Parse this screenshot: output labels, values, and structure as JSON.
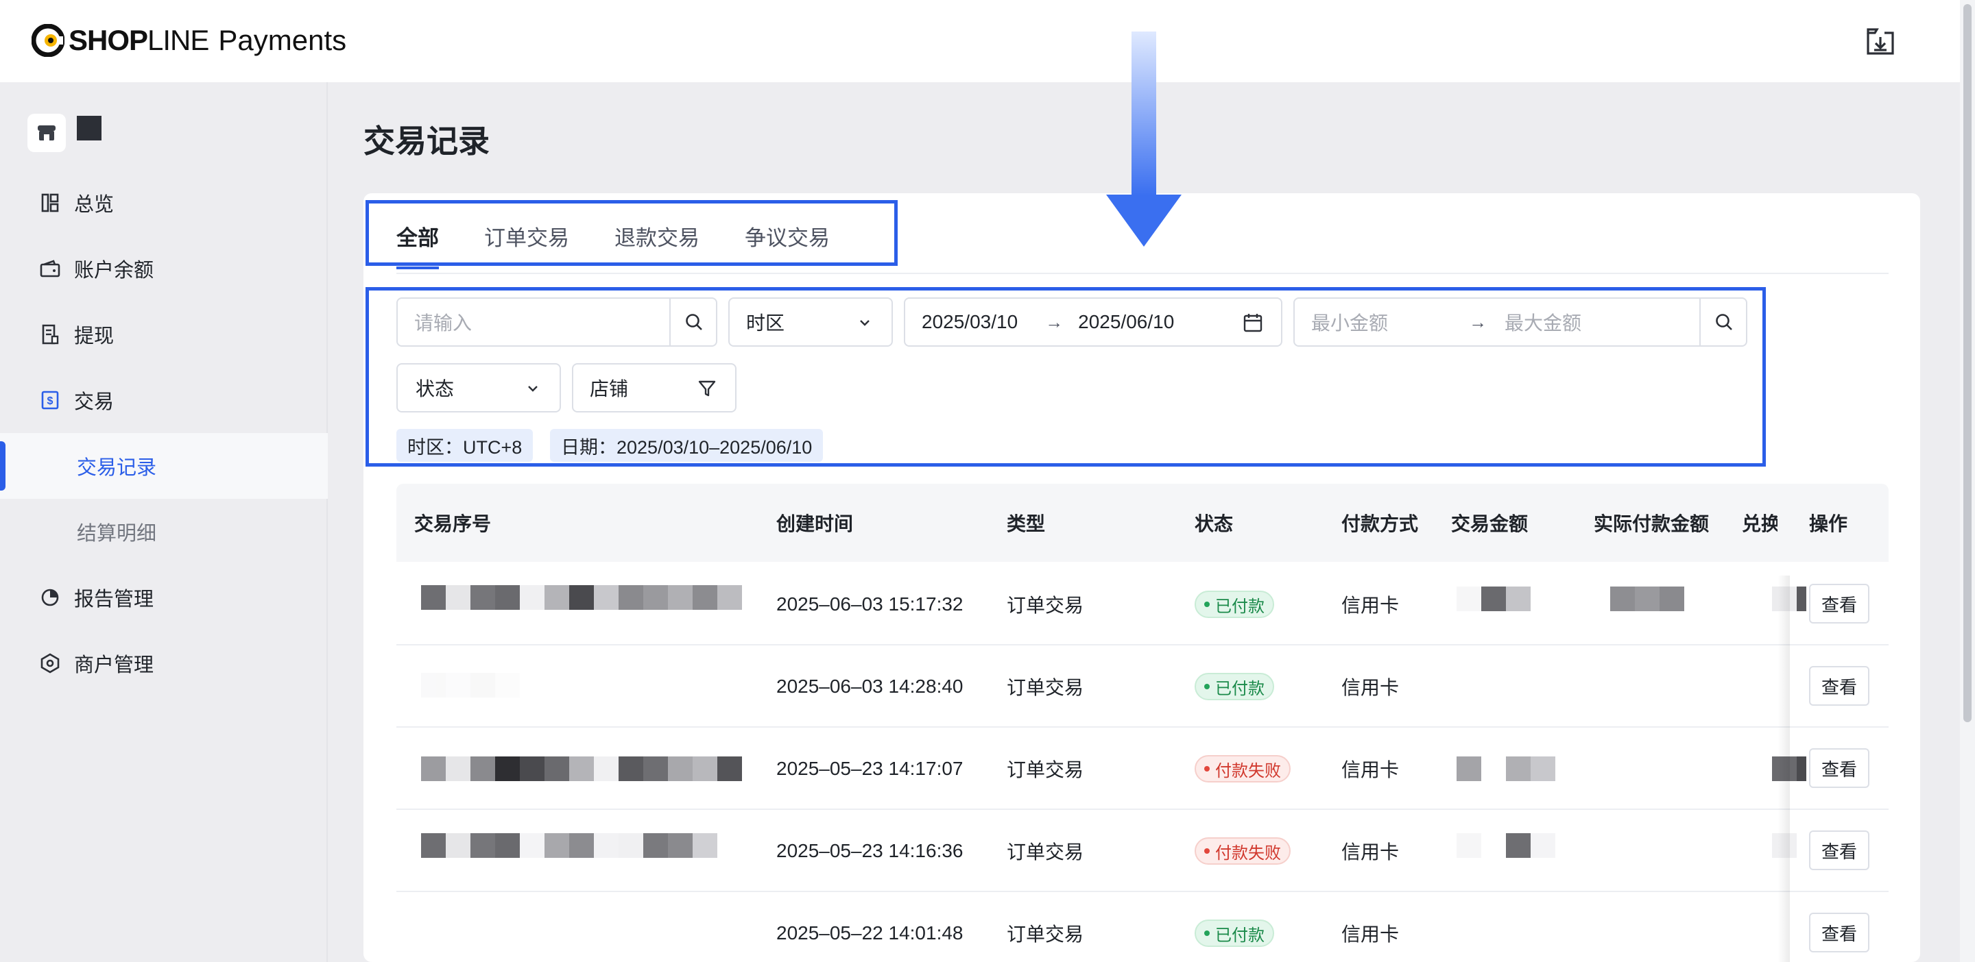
{
  "header": {
    "brand": "SHOPLINE",
    "brand_thin": "LINE",
    "brand_bold": "SHOP",
    "product": "Payments",
    "download_icon": "download-box-icon"
  },
  "sidebar": {
    "store_icon": "store-icon",
    "items": [
      {
        "label": "总览",
        "icon": "dashboard-icon"
      },
      {
        "label": "账户余额",
        "icon": "wallet-icon"
      },
      {
        "label": "提现",
        "icon": "withdraw-icon"
      },
      {
        "label": "交易",
        "icon": "dollar-doc-icon"
      },
      {
        "label": "交易记录",
        "active": true
      },
      {
        "label": "结算明细"
      },
      {
        "label": "报告管理",
        "icon": "pie-chart-icon"
      },
      {
        "label": "商户管理",
        "icon": "hexagon-settings-icon"
      }
    ]
  },
  "page": {
    "title": "交易记录"
  },
  "tabs": [
    {
      "label": "全部",
      "active": true
    },
    {
      "label": "订单交易"
    },
    {
      "label": "退款交易"
    },
    {
      "label": "争议交易"
    }
  ],
  "filters": {
    "search_placeholder": "请输入",
    "timezone_label": "时区",
    "date_start": "2025/03/10",
    "date_end": "2025/06/10",
    "amount_min_placeholder": "最小金额",
    "amount_max_placeholder": "最大金额",
    "status_label": "状态",
    "store_label": "店铺",
    "range_arrow": "→"
  },
  "active_tags": [
    {
      "text": "时区：UTC+8"
    },
    {
      "text": "日期：2025/03/10–2025/06/10"
    }
  ],
  "table": {
    "columns": [
      "交易序号",
      "创建时间",
      "类型",
      "状态",
      "付款方式",
      "交易金额",
      "实际付款金额",
      "兑换汇",
      "操作"
    ],
    "rows": [
      {
        "created": "2025–06–03 15:17:32",
        "type": "订单交易",
        "status": "已付款",
        "status_kind": "paid",
        "method": "信用卡",
        "action": "查看"
      },
      {
        "created": "2025–06–03 14:28:40",
        "type": "订单交易",
        "status": "已付款",
        "status_kind": "paid",
        "method": "信用卡",
        "action": "查看"
      },
      {
        "created": "2025–05–23 14:17:07",
        "type": "订单交易",
        "status": "付款失败",
        "status_kind": "failed",
        "method": "信用卡",
        "action": "查看"
      },
      {
        "created": "2025–05–23 14:16:36",
        "type": "订单交易",
        "status": "付款失败",
        "status_kind": "failed",
        "method": "信用卡",
        "action": "查看"
      },
      {
        "created": "2025–05–22 14:01:48",
        "type": "订单交易",
        "status": "已付款",
        "status_kind": "paid",
        "method": "信用卡",
        "action": "查看"
      }
    ]
  },
  "colors": {
    "accent": "#2b5ee8",
    "paid": "#23a35a",
    "failed": "#e2473c"
  }
}
